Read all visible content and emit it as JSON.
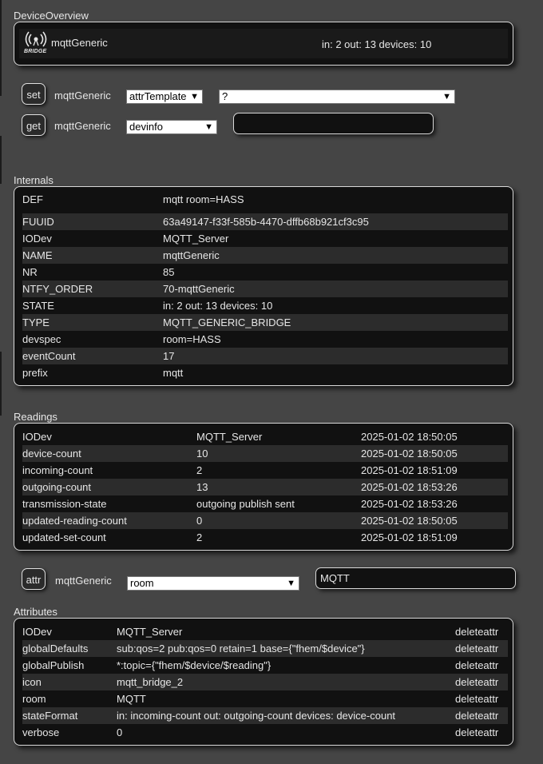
{
  "overview": {
    "section_title": "DeviceOverview",
    "device_name": "mqttGeneric",
    "icon_text": "BRIDGE",
    "state": "in: 2 out: 13 devices: 10"
  },
  "set": {
    "button_label": "set",
    "device": "mqttGeneric",
    "select_value": "attrTemplate",
    "value_select": "?"
  },
  "get": {
    "button_label": "get",
    "device": "mqttGeneric",
    "select_value": "devinfo",
    "value_input": ""
  },
  "internals": {
    "section_title": "Internals",
    "rows": [
      {
        "name": "DEF",
        "value": "mqtt room=HASS"
      },
      {
        "name": "FUUID",
        "value": "63a49147-f33f-585b-4470-dffb68b921cf3c95"
      },
      {
        "name": "IODev",
        "value": "MQTT_Server"
      },
      {
        "name": "NAME",
        "value": "mqttGeneric"
      },
      {
        "name": "NR",
        "value": "85"
      },
      {
        "name": "NTFY_ORDER",
        "value": "70-mqttGeneric"
      },
      {
        "name": "STATE",
        "value": "in: 2 out: 13 devices: 10"
      },
      {
        "name": "TYPE",
        "value": "MQTT_GENERIC_BRIDGE"
      },
      {
        "name": "devspec",
        "value": "room=HASS"
      },
      {
        "name": "eventCount",
        "value": "17"
      },
      {
        "name": "prefix",
        "value": "mqtt"
      }
    ]
  },
  "readings": {
    "section_title": "Readings",
    "rows": [
      {
        "name": "IODev",
        "value": "MQTT_Server",
        "time": "2025-01-02 18:50:05"
      },
      {
        "name": "device-count",
        "value": "10",
        "time": "2025-01-02 18:50:05"
      },
      {
        "name": "incoming-count",
        "value": "2",
        "time": "2025-01-02 18:51:09"
      },
      {
        "name": "outgoing-count",
        "value": "13",
        "time": "2025-01-02 18:53:26"
      },
      {
        "name": "transmission-state",
        "value": "outgoing publish sent",
        "time": "2025-01-02 18:53:26"
      },
      {
        "name": "updated-reading-count",
        "value": "0",
        "time": "2025-01-02 18:50:05"
      },
      {
        "name": "updated-set-count",
        "value": "2",
        "time": "2025-01-02 18:51:09"
      }
    ]
  },
  "attr": {
    "button_label": "attr",
    "device": "mqttGeneric",
    "select_value": "room",
    "value_input": "MQTT"
  },
  "attributes": {
    "section_title": "Attributes",
    "delete_label": "deleteattr",
    "rows": [
      {
        "name": "IODev",
        "value": "MQTT_Server"
      },
      {
        "name": "globalDefaults",
        "value": "sub:qos=2 pub:qos=0 retain=1 base={\"fhem/$device\"}"
      },
      {
        "name": "globalPublish",
        "value": "*:topic={\"fhem/$device/$reading\"}"
      },
      {
        "name": "icon",
        "value": "mqtt_bridge_2"
      },
      {
        "name": "room",
        "value": "MQTT"
      },
      {
        "name": "stateFormat",
        "value": "in: incoming-count out: outgoing-count devices: device-count"
      },
      {
        "name": "verbose",
        "value": "0"
      }
    ]
  }
}
